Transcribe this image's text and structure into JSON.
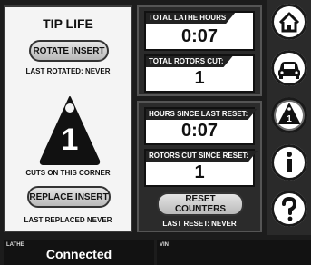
{
  "tip_life": {
    "title": "TIP LIFE",
    "rotate_label": "ROTATE INSERT",
    "last_rotated": "LAST ROTATED: NEVER",
    "cuts_value": "1",
    "cuts_caption": "CUTS ON THIS CORNER",
    "replace_label": "REPLACE INSERT",
    "last_replaced": "LAST REPLACED NEVER"
  },
  "totals": {
    "lathe_hours_label": "TOTAL LATHE HOURS",
    "lathe_hours_value": "0:07",
    "rotors_cut_label": "TOTAL ROTORS CUT:",
    "rotors_cut_value": "1"
  },
  "since_reset": {
    "hours_label": "HOURS SINCE LAST RESET:",
    "hours_value": "0:07",
    "rotors_label": "ROTORS CUT SINCE RESET:",
    "rotors_value": "1",
    "reset_button": "RESET COUNTERS",
    "last_reset": "LAST RESET: NEVER"
  },
  "nav": {
    "items": [
      {
        "icon": "home-icon"
      },
      {
        "icon": "car-icon"
      },
      {
        "icon": "tip-triangle-icon",
        "active": true
      },
      {
        "icon": "info-icon"
      },
      {
        "icon": "help-icon"
      }
    ]
  },
  "status": {
    "lathe_tag": "LATHE",
    "lathe_value": "Connected",
    "vin_tag": "VIN",
    "vin_value": ""
  }
}
